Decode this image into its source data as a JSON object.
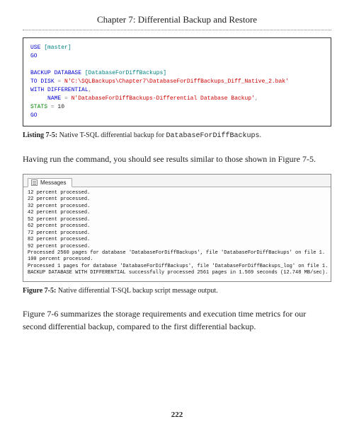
{
  "chapter_title": "Chapter 7: Differential Backup and Restore",
  "code": {
    "l1_use": "USE",
    "l1_master": " [master]",
    "l2_go": "GO",
    "l4_backup": "BACKUP",
    "l4_database": " DATABASE",
    "l4_dbname": " [DatabaseForDiffBackups]",
    "l5_to": "TO",
    "l5_disk": " DISK",
    "l5_eq": " = ",
    "l5_path": "N'C:\\SQLBackups\\Chapter7\\DatabaseForDiffBackups_Diff_Native_2.bak'",
    "l6_with": "WITH",
    "l6_diff": " DIFFERENTIAL",
    "l6_comma": ",",
    "l7_indent": "     ",
    "l7_name": "NAME",
    "l7_eq": " = ",
    "l7_val": "N'DatabaseForDiffBackups-Differential Database Backup'",
    "l7_comma": ",",
    "l8_stats": "STATS",
    "l8_eq": " = ",
    "l8_val": "10",
    "l9_go": "GO"
  },
  "listing": {
    "label": "Listing 7-5:",
    "text_pre": "     Native T-SQL differential backup for ",
    "mono": "DatabaseForDiffBackups",
    "text_post": "."
  },
  "body1": "Having run the command, you should see results similar to those shown in Figure 7-5.",
  "messages": {
    "tab_label": "Messages",
    "lines": "12 percent processed.\n22 percent processed.\n32 percent processed.\n42 percent processed.\n52 percent processed.\n62 percent processed.\n72 percent processed.\n82 percent processed.\n92 percent processed.\nProcessed 2560 pages for database 'DatabaseForDiffBackups', file 'DatabaseForDiffBackups' on file 1.\n100 percent processed.\nProcessed 1 pages for database 'DatabaseForDiffBackups', file 'DatabaseForDiffBackups_log' on file 1.\nBACKUP DATABASE WITH DIFFERENTIAL successfully processed 2561 pages in 1.569 seconds (12.748 MB/sec)."
  },
  "figure": {
    "label": "Figure 7-5:",
    "text": "     Native differential T-SQL backup script message output."
  },
  "body2": "Figure 7-6 summarizes the storage requirements and execution time metrics for our second differential backup, compared to the first differential backup.",
  "page_number": "222"
}
